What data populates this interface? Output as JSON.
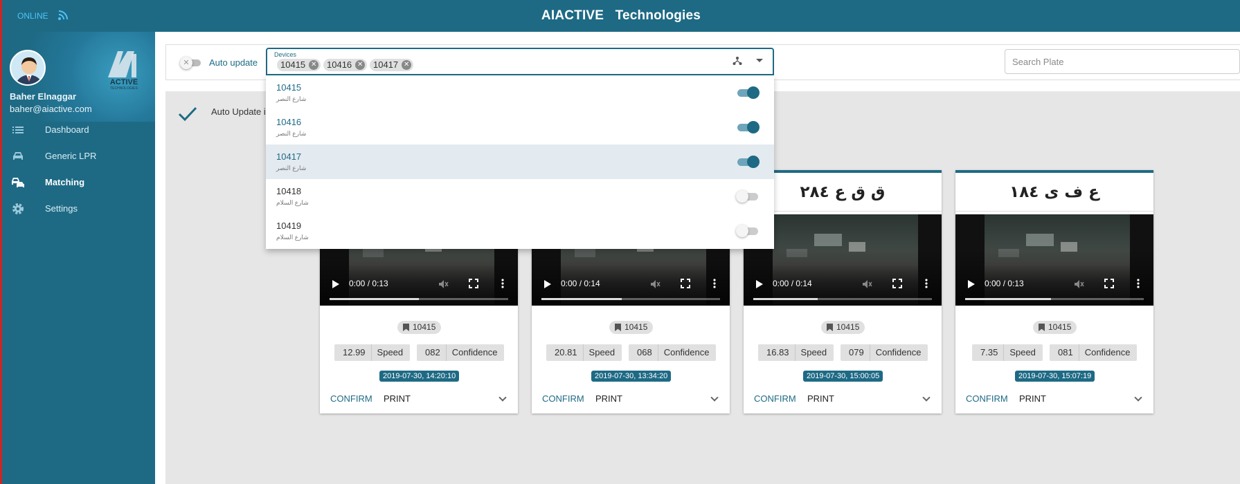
{
  "header": {
    "status": "ONLINE",
    "title": "AIACTIVE   Technologies"
  },
  "user": {
    "name": "Baher Elnaggar",
    "email": "baher@aiactive.com"
  },
  "nav": [
    {
      "label": "Dashboard",
      "icon": "list-icon",
      "active": false
    },
    {
      "label": "Generic LPR",
      "icon": "car-icon",
      "active": false
    },
    {
      "label": "Matching",
      "icon": "cars-match-icon",
      "active": true
    },
    {
      "label": "Settings",
      "icon": "gear-icon",
      "active": false
    }
  ],
  "filters": {
    "auto_update_label": "Auto update",
    "auto_update_on": false,
    "devices_legend": "Devices",
    "selected_devices": [
      "10415",
      "10416",
      "10417"
    ],
    "search_placeholder": "Search Plate"
  },
  "device_options": [
    {
      "code": "10415",
      "street": "شارع النصر",
      "enabled": true
    },
    {
      "code": "10416",
      "street": "شارع النصر",
      "enabled": true
    },
    {
      "code": "10417",
      "street": "شارع النصر",
      "enabled": true,
      "highlighted": true
    },
    {
      "code": "10418",
      "street": "شارع السلام",
      "enabled": false
    },
    {
      "code": "10419",
      "street": "شارع السلام",
      "enabled": false
    }
  ],
  "notice": {
    "text": "Auto Update i"
  },
  "cards": [
    {
      "plate": "",
      "video_time": "0:00 / 0:13",
      "progress": 0.5,
      "device": "10415",
      "speed": "12.99",
      "speed_label": "Speed",
      "confidence": "082",
      "confidence_label": "Confidence",
      "datetime": "2019-07-30, 14:20:10",
      "confirm": "CONFIRM",
      "print": "PRINT"
    },
    {
      "plate": "",
      "video_time": "0:00 / 0:14",
      "progress": 0.45,
      "device": "10415",
      "speed": "20.81",
      "speed_label": "Speed",
      "confidence": "068",
      "confidence_label": "Confidence",
      "datetime": "2019-07-30, 13:34:20",
      "confirm": "CONFIRM",
      "print": "PRINT"
    },
    {
      "plate": "ق ق ع ٢٨٤",
      "video_time": "0:00 / 0:14",
      "progress": 0.36,
      "device": "10415",
      "speed": "16.83",
      "speed_label": "Speed",
      "confidence": "079",
      "confidence_label": "Confidence",
      "datetime": "2019-07-30, 15:00:05",
      "confirm": "CONFIRM",
      "print": "PRINT"
    },
    {
      "plate": "ع ف ى ١٨٤",
      "video_time": "0:00 / 0:13",
      "progress": 0.48,
      "device": "10415",
      "speed": "7.35",
      "speed_label": "Speed",
      "confidence": "081",
      "confidence_label": "Confidence",
      "datetime": "2019-07-30, 15:07:19",
      "confirm": "CONFIRM",
      "print": "PRINT"
    }
  ],
  "colors": {
    "primary": "#1e6a85",
    "online": "#4fc3f7",
    "edge": "#c62828"
  }
}
